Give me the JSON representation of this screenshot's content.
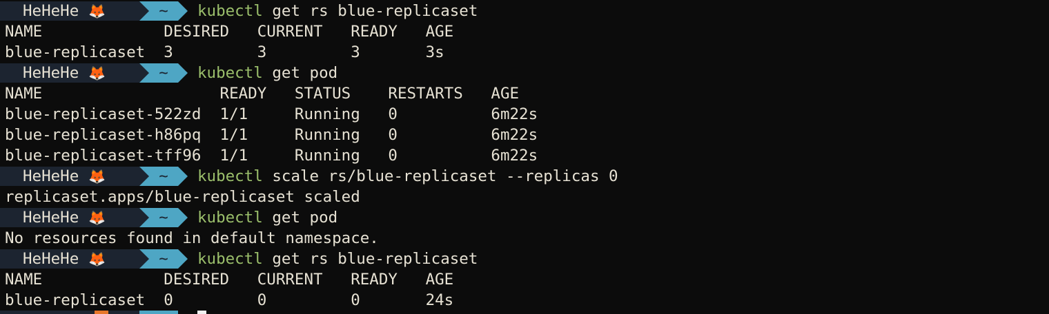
{
  "prompt": {
    "user": "HeHeHe",
    "icon": "fox-icon",
    "icon_glyph": "🦊",
    "dir": "~"
  },
  "blocks": [
    {
      "cmd_name": "kubectl",
      "cmd_args": "get rs blue-replicaset",
      "output": [
        "NAME             DESIRED   CURRENT   READY   AGE",
        "blue-replicaset  3         3         3       3s"
      ]
    },
    {
      "cmd_name": "kubectl",
      "cmd_args": "get pod",
      "output": [
        "NAME                   READY   STATUS    RESTARTS   AGE",
        "blue-replicaset-522zd  1/1     Running   0          6m22s",
        "blue-replicaset-h86pq  1/1     Running   0          6m22s",
        "blue-replicaset-tff96  1/1     Running   0          6m22s"
      ]
    },
    {
      "cmd_name": "kubectl",
      "cmd_args": "scale rs/blue-replicaset --replicas 0",
      "output": [
        "replicaset.apps/blue-replicaset scaled"
      ]
    },
    {
      "cmd_name": "kubectl",
      "cmd_args": "get pod",
      "output": [
        "No resources found in default namespace."
      ]
    },
    {
      "cmd_name": "kubectl",
      "cmd_args": "get rs blue-replicaset",
      "output": [
        "NAME             DESIRED   CURRENT   READY   AGE",
        "blue-replicaset  0         0         0       24s"
      ]
    }
  ],
  "colors": {
    "background": "#0c0c0c",
    "text": "#e6e1d3",
    "command": "#9bbf6b",
    "user_segment": "#1c2430",
    "dir_segment": "#4ea6c4"
  }
}
